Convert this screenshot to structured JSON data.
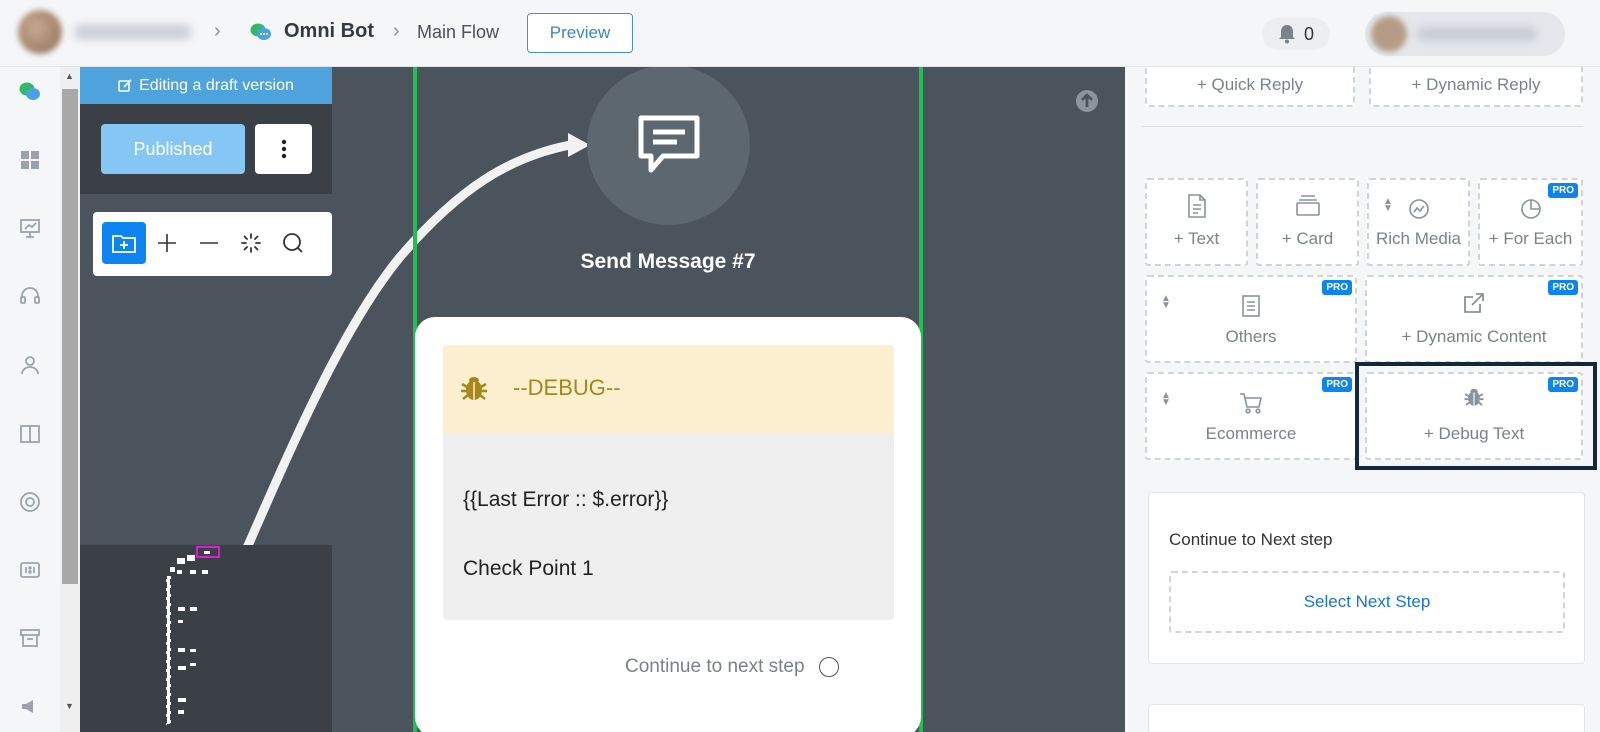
{
  "header": {
    "bot_name": "Omni Bot",
    "flow_name": "Main Flow",
    "preview_label": "Preview",
    "notification_count": "0"
  },
  "draft": {
    "banner": "Editing a draft version",
    "published_label": "Published"
  },
  "node": {
    "title": "Send Message #7",
    "debug_label": "--DEBUG--",
    "line1": "{{Last Error :: $.error}}",
    "line2": "Check Point 1",
    "continue_label": "Continue to next step"
  },
  "palette": {
    "quick_reply": "+ Quick Reply",
    "dynamic_reply": "+ Dynamic Reply",
    "text": "+ Text",
    "card": "+ Card",
    "rich_media": "Rich Media",
    "for_each": "+ For Each",
    "others": "Others",
    "dynamic_content": "+ Dynamic Content",
    "ecommerce": "Ecommerce",
    "debug_text": "+ Debug Text",
    "pro_badge": "PRO"
  },
  "next_step": {
    "title": "Continue to Next step",
    "select_label": "Select Next Step"
  },
  "colors": {
    "accent": "#0d84f2",
    "frame_green": "#1fbf54",
    "canvas": "#4b545c",
    "debug_gold": "#a8861a"
  }
}
